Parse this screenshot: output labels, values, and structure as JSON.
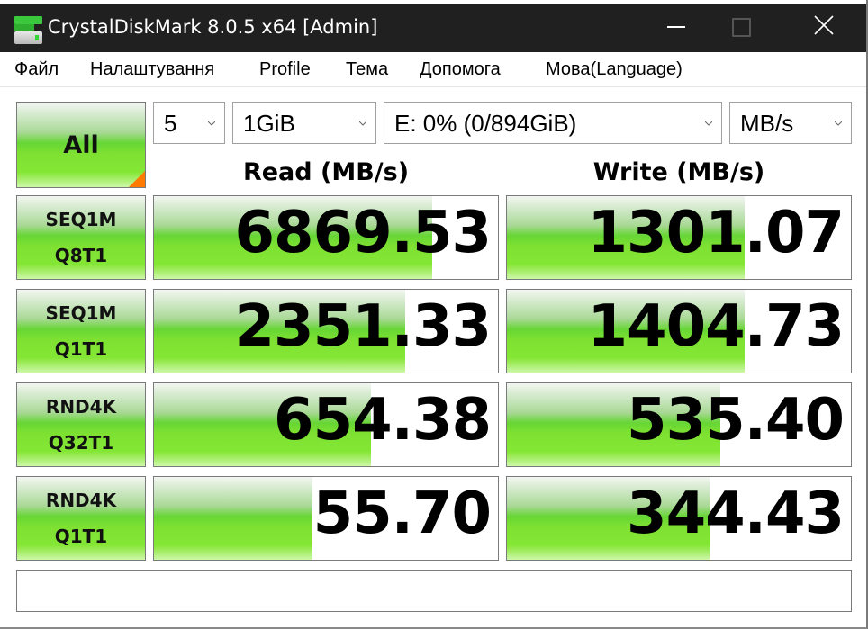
{
  "window": {
    "title": "CrystalDiskMark 8.0.5 x64 [Admin]",
    "icon": "crystaldiskmark-app-icon",
    "controls": [
      "minimize-icon",
      "maximize-icon",
      "close-icon"
    ]
  },
  "menu": {
    "items": [
      "Файл",
      "Налаштування",
      "Profile",
      "Тема",
      "Допомога",
      "Мова(Language)"
    ]
  },
  "toolbar": {
    "all_label": "All",
    "count": "5",
    "size": "1GiB",
    "drive": "E: 0% (0/894GiB)",
    "unit": "MB/s"
  },
  "headers": {
    "read": "Read (MB/s)",
    "write": "Write (MB/s)"
  },
  "colors": {
    "accent_green": "#7ee132",
    "corner_orange": "#ff7a00",
    "titlebar": "#202020"
  },
  "tests": [
    {
      "line1": "SEQ1M",
      "line2": "Q8T1",
      "read": "6869.53",
      "read_fill": 0.81,
      "write": "1301.07",
      "write_fill": 0.69
    },
    {
      "line1": "SEQ1M",
      "line2": "Q1T1",
      "read": "2351.33",
      "read_fill": 0.73,
      "write": "1404.73",
      "write_fill": 0.69
    },
    {
      "line1": "RND4K",
      "line2": "Q32T1",
      "read": "654.38",
      "read_fill": 0.63,
      "write": "535.40",
      "write_fill": 0.62
    },
    {
      "line1": "RND4K",
      "line2": "Q1T1",
      "read": "55.70",
      "read_fill": 0.46,
      "write": "344.43",
      "write_fill": 0.59
    }
  ],
  "comment": {
    "value": ""
  }
}
